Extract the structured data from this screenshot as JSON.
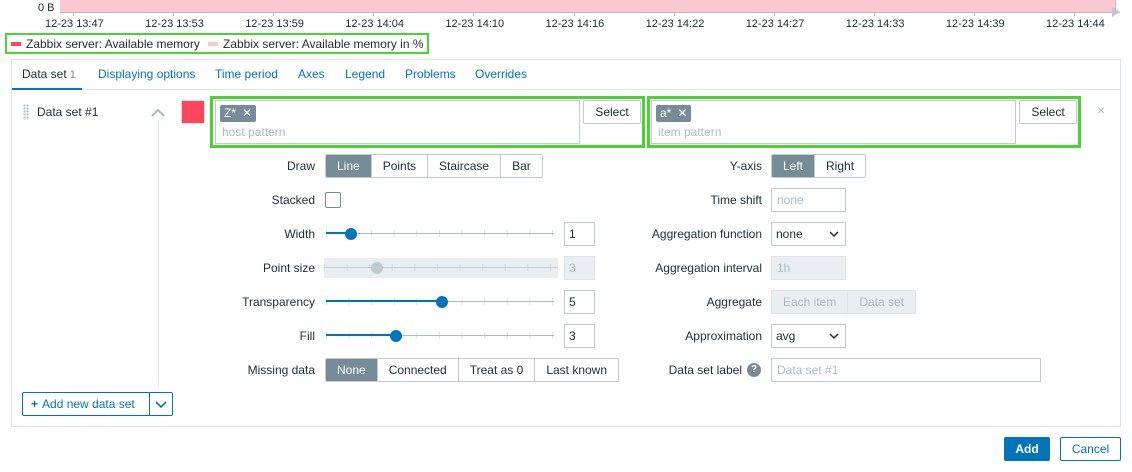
{
  "graph": {
    "y_zero_label": "0 B",
    "x_labels": [
      "12-23 13:47",
      "12-23 13:53",
      "12-23 13:59",
      "12-23 14:04",
      "12-23 14:10",
      "12-23 14:16",
      "12-23 14:22",
      "12-23 14:27",
      "12-23 14:33",
      "12-23 14:39",
      "12-23 14:44"
    ],
    "series_color": "#f9c8d1"
  },
  "legend": {
    "items": [
      {
        "label": "Zabbix server: Available memory",
        "color": "#ff465c"
      },
      {
        "label": "Zabbix server: Available memory in %",
        "color": "#f9c8d1"
      }
    ]
  },
  "tabs": [
    {
      "label": "Data set",
      "count": "1",
      "active": true
    },
    {
      "label": "Displaying options"
    },
    {
      "label": "Time period"
    },
    {
      "label": "Axes"
    },
    {
      "label": "Legend"
    },
    {
      "label": "Problems"
    },
    {
      "label": "Overrides"
    }
  ],
  "dataset": {
    "label": "Data set #1",
    "color": "#ff465c",
    "host": {
      "chip": "Z*",
      "placeholder": "host pattern",
      "select_label": "Select"
    },
    "item": {
      "chip": "a*",
      "placeholder": "item pattern",
      "select_label": "Select"
    },
    "remove_label": "×"
  },
  "form_left": {
    "draw": {
      "label": "Draw",
      "options": [
        "Line",
        "Points",
        "Staircase",
        "Bar"
      ],
      "selected": 0
    },
    "stacked": {
      "label": "Stacked",
      "checked": false
    },
    "width": {
      "label": "Width",
      "value": "1",
      "fraction": 0.1
    },
    "point_size": {
      "label": "Point size",
      "value": "3",
      "fraction": 0.2
    },
    "transparency": {
      "label": "Transparency",
      "value": "5",
      "fraction": 0.5
    },
    "fill": {
      "label": "Fill",
      "value": "3",
      "fraction": 0.3
    },
    "missing_data": {
      "label": "Missing data",
      "options": [
        "None",
        "Connected",
        "Treat as 0",
        "Last known"
      ],
      "selected": 0
    }
  },
  "form_right": {
    "y_axis": {
      "label": "Y-axis",
      "options": [
        "Left",
        "Right"
      ],
      "selected": 0
    },
    "time_shift": {
      "label": "Time shift",
      "placeholder": "none"
    },
    "aggregation_function": {
      "label": "Aggregation function",
      "value": "none"
    },
    "aggregation_interval": {
      "label": "Aggregation interval",
      "placeholder": "1h"
    },
    "aggregate": {
      "label": "Aggregate",
      "options": [
        "Each item",
        "Data set"
      ]
    },
    "approximation": {
      "label": "Approximation",
      "value": "avg"
    },
    "dataset_label": {
      "label": "Data set label",
      "placeholder": "Data set #1",
      "help": "?"
    }
  },
  "actions": {
    "add_dataset_label": "Add new data set",
    "add_label": "Add",
    "cancel_label": "Cancel"
  }
}
